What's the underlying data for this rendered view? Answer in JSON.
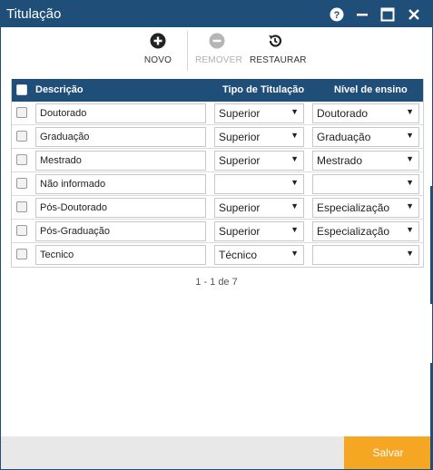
{
  "window": {
    "title": "Titulação"
  },
  "colors": {
    "accent": "#1f4e79",
    "save": "#f5a623"
  },
  "toolbar": {
    "novo": {
      "label": "NOVO",
      "icon": "plus-circle-icon"
    },
    "remover": {
      "label": "REMOVER",
      "icon": "minus-circle-icon",
      "disabled": true
    },
    "restaurar": {
      "label": "RESTAURAR",
      "icon": "restore-icon"
    }
  },
  "grid": {
    "headers": {
      "descricao": "Descrição",
      "tipo": "Tipo de Titulação",
      "nivel": "Nível de ensino"
    },
    "rows": [
      {
        "descricao": "Doutorado",
        "tipo": "Superior",
        "nivel": "Doutorado"
      },
      {
        "descricao": "Graduação",
        "tipo": "Superior",
        "nivel": "Graduação"
      },
      {
        "descricao": "Mestrado",
        "tipo": "Superior",
        "nivel": "Mestrado"
      },
      {
        "descricao": "Não informado",
        "tipo": "",
        "nivel": ""
      },
      {
        "descricao": "Pós-Doutorado",
        "tipo": "Superior",
        "nivel": "Especialização"
      },
      {
        "descricao": "Pós-Graduação",
        "tipo": "Superior",
        "nivel": "Especialização"
      },
      {
        "descricao": "Tecnico",
        "tipo": "Técnico",
        "nivel": ""
      }
    ],
    "pager": "1 - 1 de 7"
  },
  "footer": {
    "save_label": "Salvar"
  }
}
